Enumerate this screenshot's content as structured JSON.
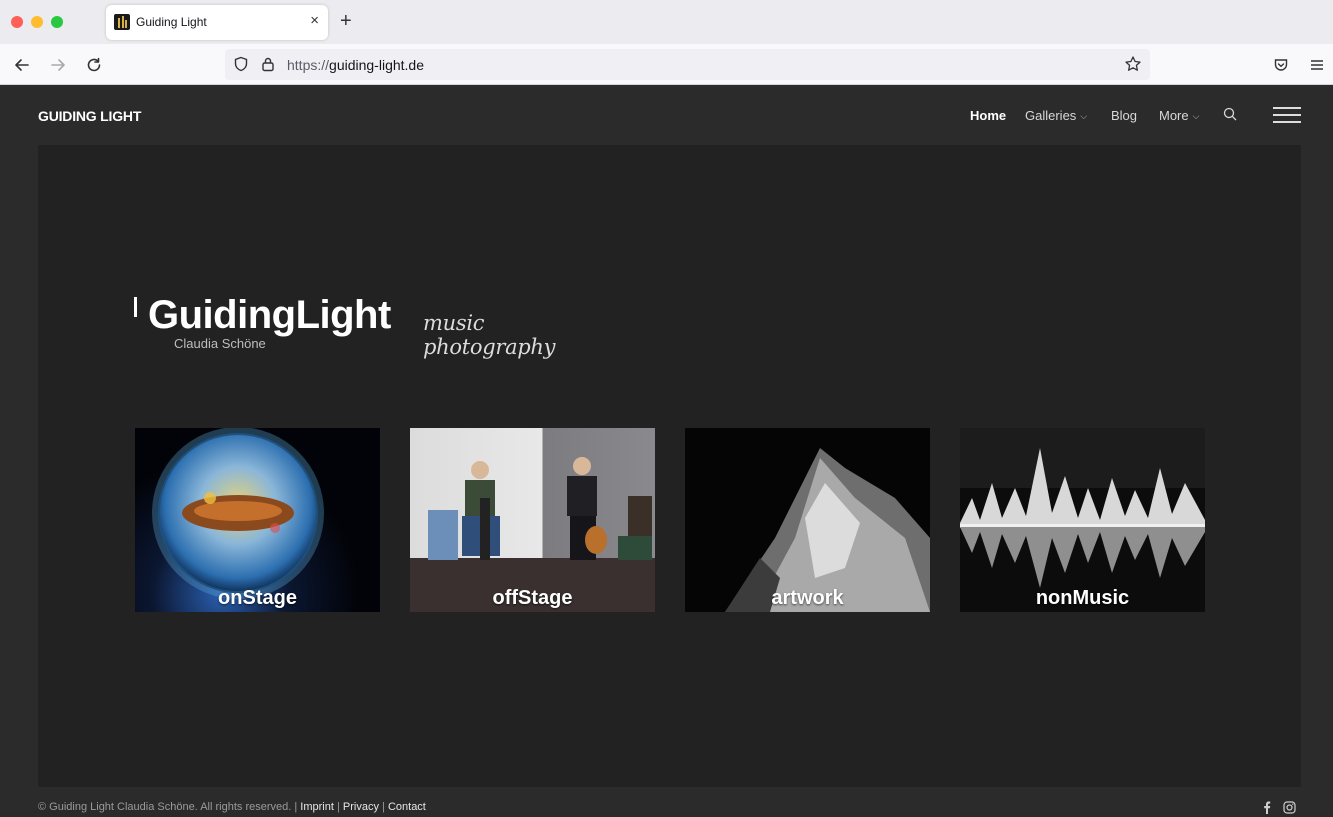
{
  "browser": {
    "tab_title": "Guiding Light",
    "url_scheme": "https://",
    "url_host": "guiding-light.de",
    "new_tab_glyph": "+",
    "close_glyph": "×"
  },
  "site": {
    "logo": "GUIDING LIGHT",
    "nav": {
      "home": "Home",
      "galleries": "Galleries",
      "blog": "Blog",
      "more": "More"
    },
    "brand": {
      "name": "GuidingLight",
      "subtitle": "Claudia Schöne",
      "tagline": "music photography"
    },
    "galleries": [
      {
        "label": "onStage"
      },
      {
        "label": "offStage"
      },
      {
        "label": "artwork"
      },
      {
        "label": "nonMusic"
      }
    ],
    "footer": {
      "copyright": "© Guiding Light Claudia Schöne. All rights reserved.",
      "sep": " | ",
      "imprint": "Imprint",
      "privacy": "Privacy",
      "contact": "Contact"
    }
  },
  "icons": {
    "back": "back-arrow-icon",
    "forward": "forward-arrow-icon",
    "reload": "reload-icon",
    "shield": "shield-icon",
    "lock": "lock-icon",
    "star": "bookmark-star-icon",
    "pocket": "pocket-icon",
    "menu": "app-menu-icon",
    "search": "search-icon",
    "hamburger": "hamburger-icon",
    "facebook": "facebook-icon",
    "instagram": "instagram-icon"
  }
}
